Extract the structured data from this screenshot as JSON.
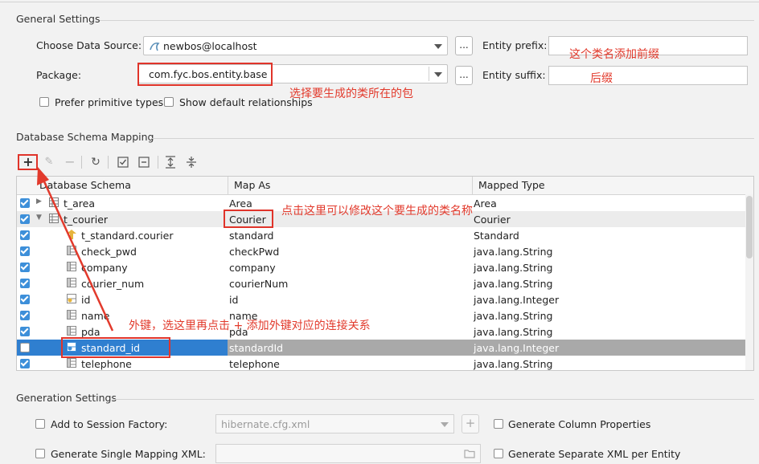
{
  "general": {
    "section_title": "General Settings",
    "data_source_label": "Choose Data Source:",
    "data_source_value": "newbos@localhost",
    "data_source_browse": "...",
    "entity_prefix_label": "Entity prefix:",
    "package_label": "Package:",
    "package_value": "com.fyc.bos.entity.base",
    "package_browse": "...",
    "entity_suffix_label": "Entity suffix:",
    "prefer_primitive_label": "Prefer primitive types",
    "show_default_relationships_label": "Show default relationships"
  },
  "annotations": {
    "prefix_note": "这个类名添加前缀",
    "suffix_note": "后缀",
    "package_note": "选择要生成的类所在的包",
    "mapas_note": "点击这里可以修改这个要生成的类名称",
    "fk_note": "外键，选这里再点击 + 添加外键对应的连接关系"
  },
  "mapping": {
    "section_title": "Database Schema Mapping",
    "toolbar": [
      "add-icon",
      "edit-icon",
      "remove-icon",
      "refresh-icon",
      "check-all-icon",
      "uncheck-all-icon",
      "expand-all-icon",
      "collapse-all-icon"
    ],
    "columns": [
      "Database Schema",
      "Map As",
      "Mapped Type"
    ],
    "rows": [
      {
        "name": "t_area",
        "map_as": "Area",
        "type": "Area",
        "level": 0,
        "checked": true,
        "expander": "▶",
        "icon": "table-icon"
      },
      {
        "name": "t_courier",
        "map_as": "Courier",
        "type": "Courier",
        "level": 0,
        "checked": true,
        "expander": "▼",
        "icon": "table-icon"
      },
      {
        "name": "t_standard.courier",
        "map_as": "standard",
        "type": "Standard",
        "level": 1,
        "checked": true,
        "expander": "",
        "icon": "relation-icon"
      },
      {
        "name": "check_pwd",
        "map_as": "checkPwd",
        "type": "java.lang.String",
        "level": 1,
        "checked": true,
        "expander": "",
        "icon": "column-icon"
      },
      {
        "name": "company",
        "map_as": "company",
        "type": "java.lang.String",
        "level": 1,
        "checked": true,
        "expander": "",
        "icon": "column-icon"
      },
      {
        "name": "courier_num",
        "map_as": "courierNum",
        "type": "java.lang.String",
        "level": 1,
        "checked": true,
        "expander": "",
        "icon": "column-icon"
      },
      {
        "name": "id",
        "map_as": "id",
        "type": "java.lang.Integer",
        "level": 1,
        "checked": true,
        "expander": "",
        "icon": "key-column-icon"
      },
      {
        "name": "name",
        "map_as": "name",
        "type": "java.lang.String",
        "level": 1,
        "checked": true,
        "expander": "",
        "icon": "column-icon"
      },
      {
        "name": "pda",
        "map_as": "pda",
        "type": "java.lang.String",
        "level": 1,
        "checked": true,
        "expander": "",
        "icon": "column-icon"
      },
      {
        "name": "standard_id",
        "map_as": "standardId",
        "type": "java.lang.Integer",
        "level": 1,
        "checked": false,
        "expander": "",
        "icon": "fk-column-icon",
        "selected": true
      },
      {
        "name": "telephone",
        "map_as": "telephone",
        "type": "java.lang.String",
        "level": 1,
        "checked": true,
        "expander": "",
        "icon": "column-icon"
      }
    ]
  },
  "generation": {
    "section_title": "Generation Settings",
    "session_factory_label": "Add to Session Factory:",
    "session_factory_value": "hibernate.cfg.xml",
    "session_factory_add": "+",
    "single_mapping_label": "Generate Single Mapping XML:",
    "column_props_label": "Generate Column Properties",
    "separate_xml_label": "Generate Separate XML per Entity"
  },
  "colors": {
    "accent": "#3d8fd9",
    "annotation_red": "#e23a2c",
    "selected_row": "#a9a9a9"
  }
}
